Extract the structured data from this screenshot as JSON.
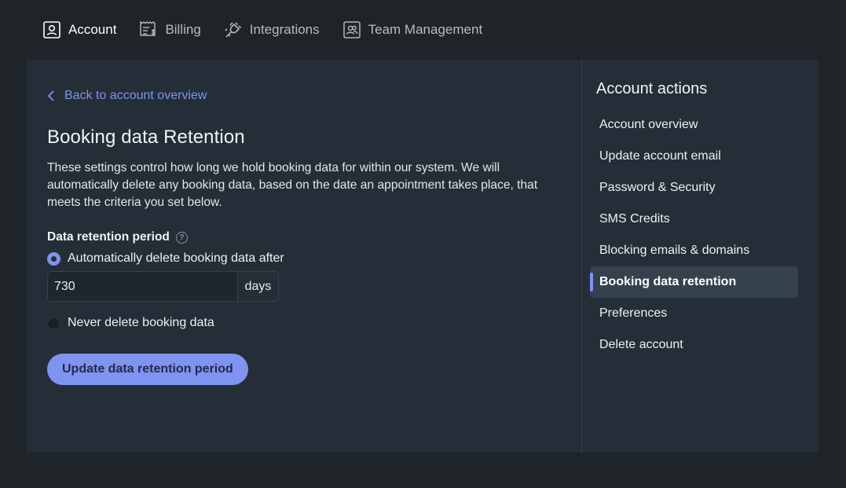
{
  "tabs": [
    {
      "label": "Account",
      "icon": "user-badge-icon",
      "active": true
    },
    {
      "label": "Billing",
      "icon": "receipt-icon",
      "active": false
    },
    {
      "label": "Integrations",
      "icon": "plug-icon",
      "active": false
    },
    {
      "label": "Team Management",
      "icon": "team-icon",
      "active": false
    }
  ],
  "back_link": "Back to account overview",
  "page_title": "Booking data Retention",
  "description": "These settings control how long we hold booking data for within our system. We will automatically delete any booking data, based on the date an appointment takes place, that meets the criteria you set below.",
  "retention": {
    "label": "Data retention period",
    "help_glyph": "?",
    "option_auto": "Automatically delete booking data after",
    "option_never": "Never delete booking data",
    "selected": "auto",
    "days_value": "730",
    "days_suffix": "days"
  },
  "submit_label": "Update data retention period",
  "sidebar": {
    "title": "Account actions",
    "items": [
      {
        "label": "Account overview"
      },
      {
        "label": "Update account email"
      },
      {
        "label": "Password & Security"
      },
      {
        "label": "SMS Credits"
      },
      {
        "label": "Blocking emails & domains"
      },
      {
        "label": "Booking data retention",
        "active": true
      },
      {
        "label": "Preferences"
      },
      {
        "label": "Delete account"
      }
    ]
  },
  "colors": {
    "accent": "#7f93f0",
    "background": "#1e2428",
    "panel": "#252e36"
  }
}
